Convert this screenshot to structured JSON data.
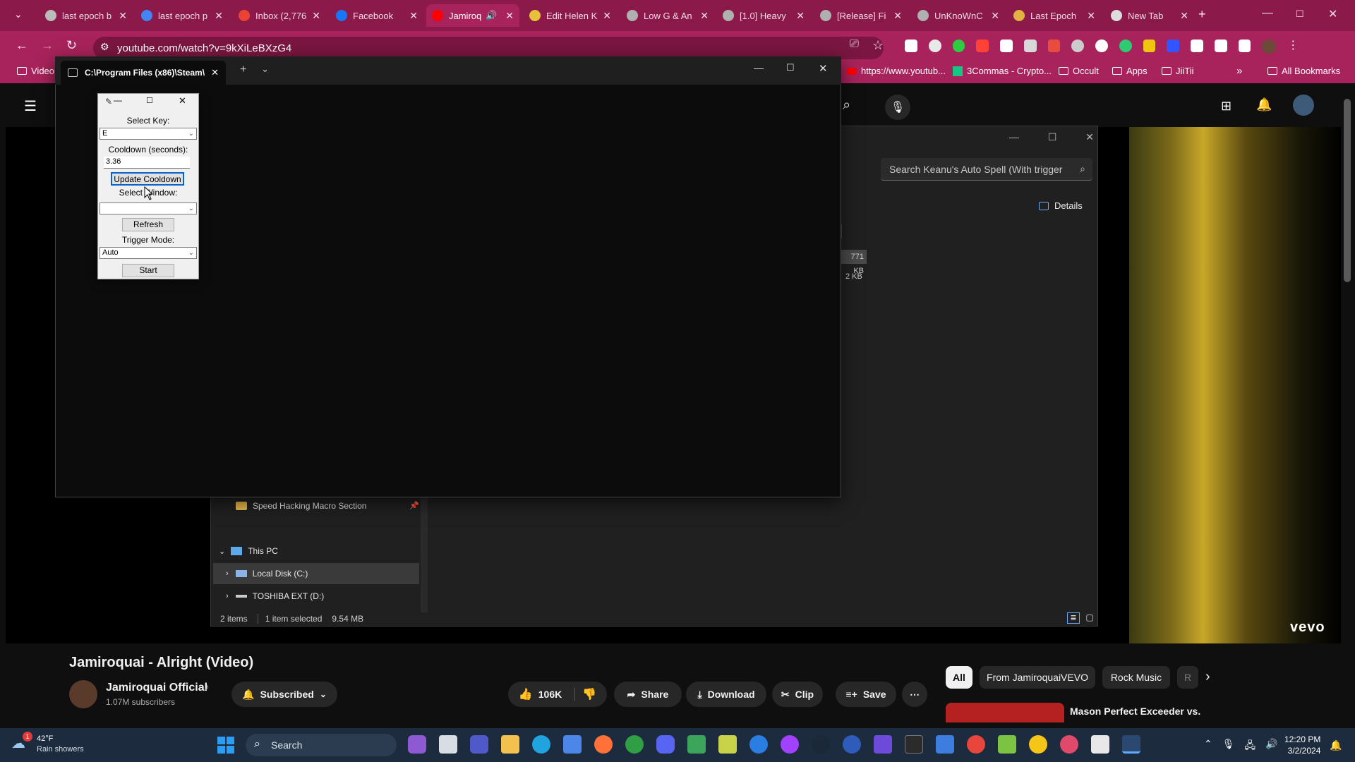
{
  "browser": {
    "tabs": [
      {
        "label": "last epoch b",
        "color": "#bbbbbb"
      },
      {
        "label": "last epoch p",
        "color": "#4285f4"
      },
      {
        "label": "Inbox (2,776",
        "color": "#ea4335"
      },
      {
        "label": "Facebook",
        "color": "#1877f2"
      },
      {
        "label": "Jamiroq",
        "color": "#ff0000"
      },
      {
        "label": "Edit Helen K",
        "color": "#e8c13a"
      },
      {
        "label": "Low G & An",
        "color": "#b0b0b0"
      },
      {
        "label": "[1.0] Heavy",
        "color": "#b0b0b0"
      },
      {
        "label": "[Release] Fi",
        "color": "#b0b0b0"
      },
      {
        "label": "UnKnoWnC",
        "color": "#b0b0b0"
      },
      {
        "label": "Last Epoch",
        "color": "#e3b341"
      },
      {
        "label": "New Tab",
        "color": "#dddddd"
      }
    ],
    "url": "youtube.com/watch?v=9kXiLeBXzG4",
    "bookmarks": [
      "Video",
      "https://www.youtub...",
      "3Commas - Crypto...",
      "Occult",
      "Apps",
      "JiiTii",
      "All Bookmarks"
    ]
  },
  "terminal": {
    "tab_title": "C:\\Program Files (x86)\\Steam\\"
  },
  "dialog": {
    "select_key_label": "Select Key:",
    "select_key_value": "E",
    "cooldown_label": "Cooldown (seconds):",
    "cooldown_value": "3.36",
    "update_button": "Update Cooldown",
    "select_window_label": "Select Window:",
    "select_window_value": "",
    "refresh_button": "Refresh",
    "trigger_mode_label": "Trigger Mode:",
    "trigger_mode_value": "Auto",
    "start_button": "Start"
  },
  "explorer": {
    "search_placeholder": "Search Keanu's Auto Spell (With trigger",
    "details_label": "Details",
    "file_sizes": [
      "771 KB",
      "2 KB"
    ],
    "nav": {
      "pinned": "Speed Hacking Macro Section",
      "this_pc": "This PC",
      "local_disk": "Local Disk (C:)",
      "toshiba": "TOSHIBA EXT (D:)"
    },
    "status": {
      "items": "2 items",
      "selected": "1 item selected",
      "size": "9.54 MB"
    }
  },
  "youtube": {
    "video_title": "Jamiroquai - Alright (Video)",
    "channel_name": "Jamiroquai Official",
    "subscribers": "1.07M subscribers",
    "subscribed_label": "Subscribed",
    "likes": "106K",
    "share": "Share",
    "download": "Download",
    "clip": "Clip",
    "save": "Save",
    "watermark": "vevo",
    "chips": [
      "All",
      "From JamiroquaiVEVO",
      "Rock Music",
      "R"
    ],
    "recommended_title": "Mason Perfect Exceeder vs."
  },
  "taskbar": {
    "weather_temp": "42°F",
    "weather_desc": "Rain showers",
    "weather_badge": "1",
    "search_placeholder": "Search",
    "time": "12:20 PM",
    "date": "3/2/2024"
  }
}
